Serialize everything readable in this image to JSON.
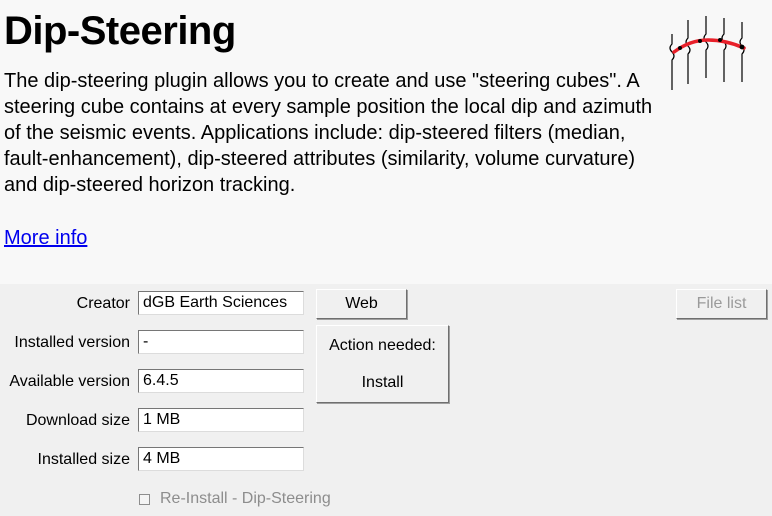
{
  "plugin": {
    "title": "Dip-Steering",
    "description": "The dip-steering plugin allows you to create and use \"steering cubes\". A steering cube contains at every sample position the local dip and azimuth of the seismic events. Applications include: dip-steered filters (median, fault-enhancement), dip-steered attributes (similarity, volume curvature) and dip-steered horizon tracking.",
    "more_info": "More info",
    "logo_icon": "dip-steering-logo-icon"
  },
  "fields": {
    "creator": {
      "label": "Creator",
      "value": "dGB Earth Sciences"
    },
    "installed_version": {
      "label": "Installed version",
      "value": "-"
    },
    "available_version": {
      "label": "Available version",
      "value": "6.4.5"
    },
    "download_size": {
      "label": "Download size",
      "value": "1 MB"
    },
    "installed_size": {
      "label": "Installed size",
      "value": "4 MB"
    }
  },
  "buttons": {
    "web": "Web",
    "file_list": "File list",
    "action_line1": "Action needed:",
    "action_line2": "Install"
  },
  "reinstall": {
    "label": "Re-Install - Dip-Steering",
    "checked": false
  },
  "colors": {
    "logo_curve": "#e8202a",
    "link": "#0000ee",
    "disabled_text": "#8d8d8d"
  }
}
